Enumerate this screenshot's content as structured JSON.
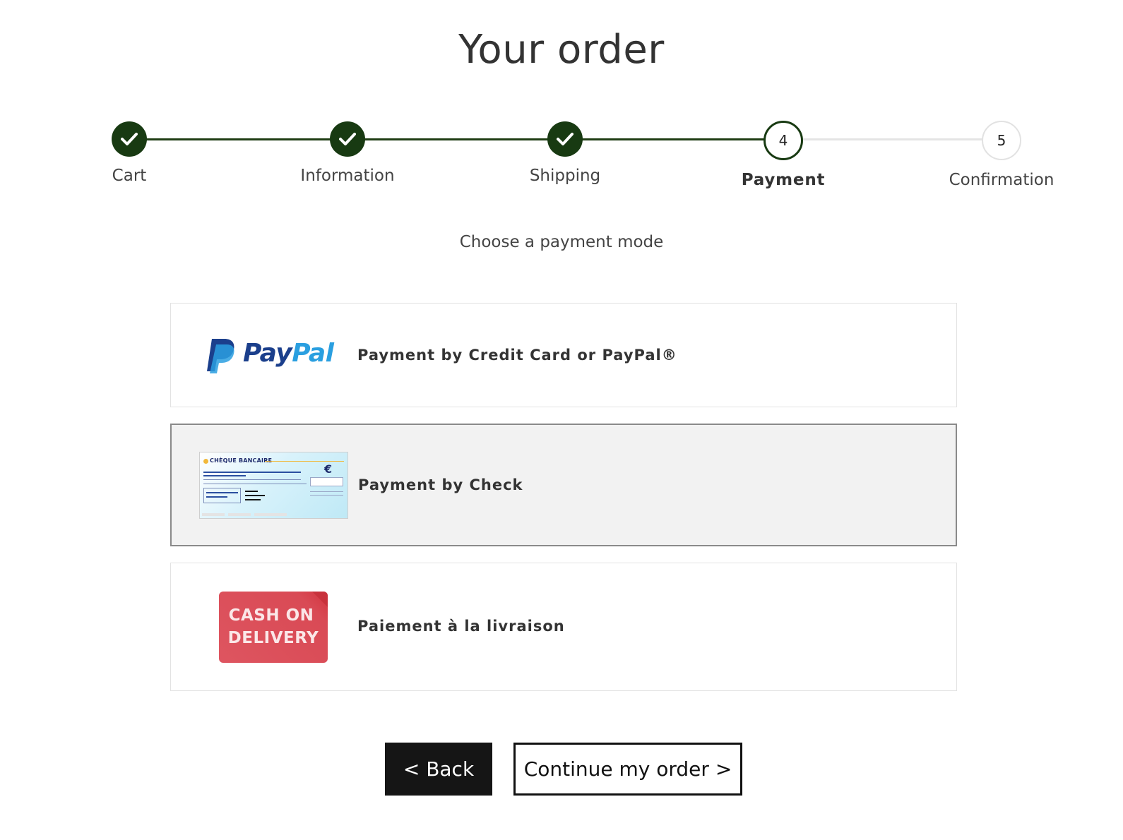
{
  "title": "Your order",
  "steps": [
    {
      "label": "Cart",
      "state": "done"
    },
    {
      "label": "Information",
      "state": "done"
    },
    {
      "label": "Shipping",
      "state": "done"
    },
    {
      "label": "Payment",
      "number": "4",
      "state": "active"
    },
    {
      "label": "Confirmation",
      "number": "5",
      "state": "todo"
    }
  ],
  "subtitle": "Choose a payment mode",
  "payment_options": [
    {
      "label": "Payment by Credit Card or PayPal®",
      "logo": "PayPal",
      "logo_pay": "Pay",
      "logo_pal": "Pal",
      "selected": false
    },
    {
      "label": "Payment by Check",
      "logo": "check-image",
      "check_heading": "CHÈQUE BANCAIRE",
      "check_currency": "€",
      "selected": true
    },
    {
      "label": "Paiement à la livraison",
      "logo_line1": "CASH ON",
      "logo_line2": "DELIVERY",
      "selected": false
    }
  ],
  "buttons": {
    "back": "< Back",
    "continue": "Continue my order >"
  },
  "colors": {
    "step_done": "#183a12",
    "paypal_dark": "#1b3f8c",
    "paypal_light": "#2a9fe0",
    "cod_red": "#d94a55",
    "button_dark": "#151515"
  }
}
